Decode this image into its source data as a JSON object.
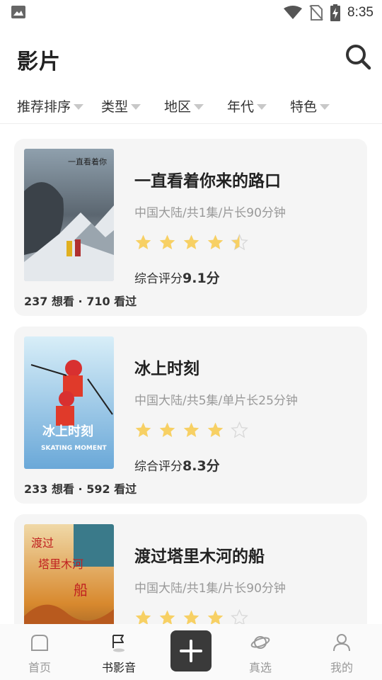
{
  "status_bar": {
    "time": "8:35",
    "icons": [
      "image-icon",
      "wifi-icon",
      "no-sim-icon",
      "battery-charging-icon"
    ]
  },
  "header": {
    "title": "影片",
    "search_icon": "search-icon"
  },
  "filters": [
    {
      "label": "推荐排序"
    },
    {
      "label": "类型"
    },
    {
      "label": "地区"
    },
    {
      "label": "年代"
    },
    {
      "label": "特色"
    }
  ],
  "movies": [
    {
      "title": "一直看着你来的路口",
      "meta": "中国大陆/共1集/片长90分钟",
      "stars": 4.5,
      "rating_prefix": "综合评分",
      "score": "9.1分",
      "counts": "237 想看 · 710 看过",
      "poster_text": "一直看着你来的路口"
    },
    {
      "title": "冰上时刻",
      "meta": "中国大陆/共5集/单片长25分钟",
      "stars": 4,
      "rating_prefix": "综合评分",
      "score": "8.3分",
      "counts": "233 想看 · 592 看过",
      "poster_text": "冰上时刻",
      "poster_subtext": "SKATING MOMENT"
    },
    {
      "title": "渡过塔里木河的船",
      "meta": "中国大陆/共1集/片长90分钟",
      "stars": 4,
      "poster_text": "渡过塔里木河的船"
    }
  ],
  "bottom_nav": [
    {
      "label": "首页",
      "icon": "home-icon"
    },
    {
      "label": "书影音",
      "icon": "flag-icon",
      "active": true
    },
    {
      "label": "",
      "icon": "plus-icon"
    },
    {
      "label": "真选",
      "icon": "planet-icon"
    },
    {
      "label": "我的",
      "icon": "user-icon"
    }
  ],
  "colors": {
    "star_filled": "#f7d064",
    "star_empty": "#d8d8d8",
    "card_bg": "#f5f5f5",
    "add_button": "#3a3a3a"
  }
}
